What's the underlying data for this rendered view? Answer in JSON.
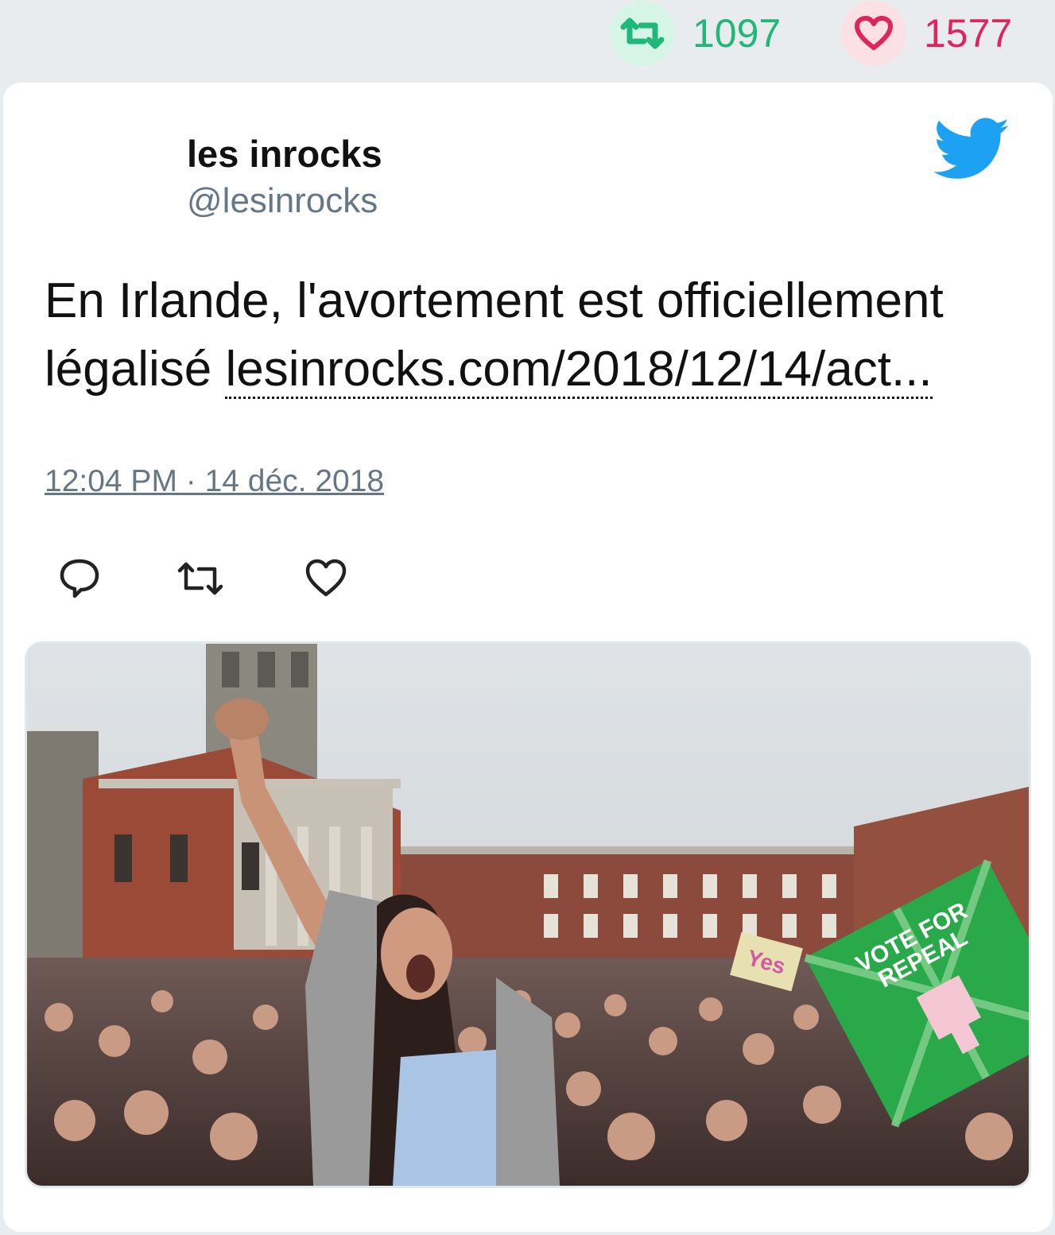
{
  "stats": {
    "retweets": "1097",
    "likes": "1577",
    "retweet_color": "#1fb87a",
    "like_color": "#e0245e"
  },
  "author": {
    "name": "les inrocks",
    "handle": "@lesinrocks"
  },
  "tweet": {
    "text": "En Irlande, l'avortement est officiellement légalisé ",
    "link": "lesinrocks.com/2018/12/14/act...",
    "timestamp": "12:04 PM · 14 déc. 2018"
  },
  "actions": {
    "reply_icon": "reply-icon",
    "retweet_icon": "retweet-icon",
    "like_icon": "heart-icon"
  },
  "media": {
    "sign_text_1": "VOTE FOR",
    "sign_text_2": "REPEAL",
    "sign_small": "Yes",
    "accent": "#2aa94a"
  },
  "brand": {
    "twitter_blue": "#1da1f2"
  }
}
